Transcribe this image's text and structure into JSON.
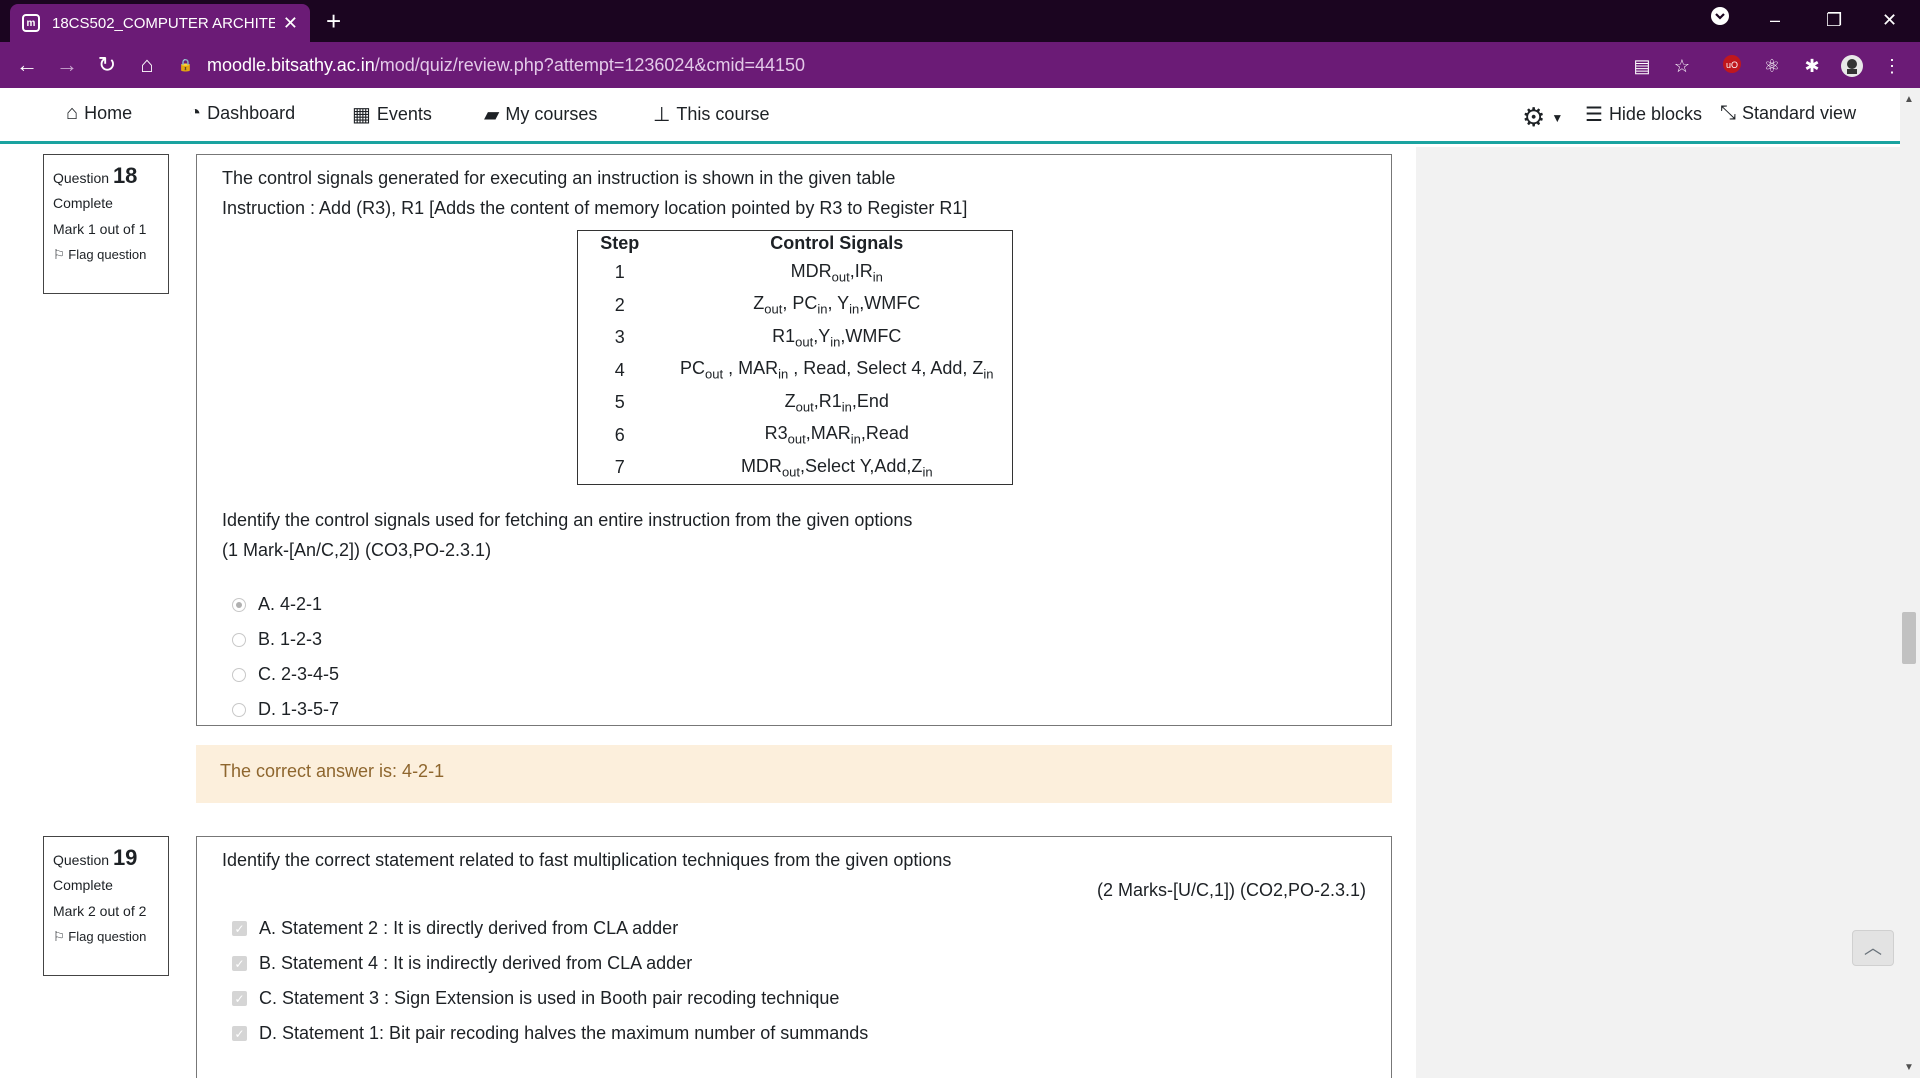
{
  "browser": {
    "tab_title": "18CS502_COMPUTER ARCHITECTURE",
    "url_host": "moodle.bitsathy.ac.in",
    "url_path": "/mod/quiz/review.php?attempt=1236024&cmid=44150",
    "accent_color": "#6b1b76"
  },
  "nav": {
    "home": "Home",
    "dashboard": "Dashboard",
    "events": "Events",
    "my_courses": "My courses",
    "this_course": "This course",
    "hide_blocks": "Hide blocks",
    "standard_view": "Standard view"
  },
  "q18": {
    "label": "Question",
    "number": "18",
    "state": "Complete",
    "grade": "Mark 1 out of 1",
    "flag": "Flag question",
    "line1": "The control signals generated for executing an instruction is shown in the given table",
    "line2": "Instruction : Add (R3), R1 [Adds the content of memory location pointed by R3 to Register R1]",
    "table_headers": [
      "Step",
      "Control Signals"
    ],
    "table_steps": [
      "1",
      "2",
      "3",
      "4",
      "5",
      "6",
      "7"
    ],
    "line3": "Identify the control signals used for fetching an entire instruction from the given options",
    "marks": "(1 Mark-[An/C,2]) (CO3,PO-2.3.1)",
    "options": [
      "A. 4-2-1",
      "B. 1-2-3",
      "C. 2-3-4-5",
      "D. 1-3-5-7"
    ],
    "selected_option": "A. 4-2-1",
    "feedback": "The correct answer is: 4-2-1"
  },
  "q19": {
    "label": "Question",
    "number": "19",
    "state": "Complete",
    "grade": "Mark 2 out of 2",
    "flag": "Flag question",
    "text": "Identify the correct statement related to fast multiplication techniques from the given options",
    "marks": "(2 Marks-[U/C,1]) (CO2,PO-2.3.1)",
    "options": [
      "A. Statement 2 : It is directly derived from CLA adder",
      "B. Statement 4 : It is indirectly derived from CLA adder",
      "C. Statement 3 : Sign Extension is used in Booth pair recoding technique",
      "D. Statement 1: Bit pair recoding halves the maximum number of summands"
    ]
  }
}
